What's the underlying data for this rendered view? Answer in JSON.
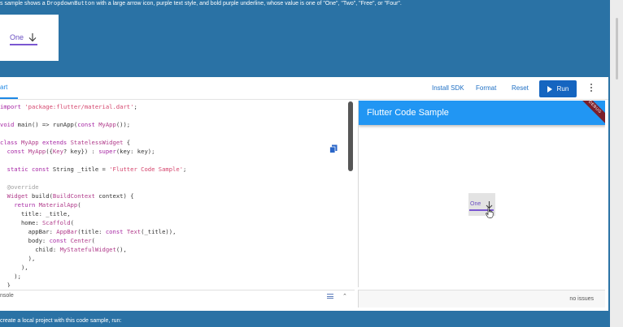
{
  "description": {
    "prefix": "s sample shows a ",
    "code": "DropdownButton",
    "suffix": " with a large arrow icon, purple text style, and bold purple underline, whose value is one of \"One\", \"Two\", \"Free\", or \"Four\"."
  },
  "sample_card": {
    "value": "One"
  },
  "toolbar": {
    "tab": "art",
    "install_sdk": "Install SDK",
    "format": "Format",
    "reset": "Reset",
    "run": "Run"
  },
  "code_lines": [
    [
      [
        "kw",
        "import "
      ],
      [
        "st",
        "'package:flutter/material.dart'"
      ],
      [
        "",
        "; "
      ]
    ],
    [],
    [
      [
        "kw",
        "void "
      ],
      [
        "",
        "main() => runApp("
      ],
      [
        "kw",
        "const "
      ],
      [
        "ty",
        "MyApp"
      ],
      [
        "",
        "());"
      ]
    ],
    [],
    [
      [
        "kw",
        "class "
      ],
      [
        "ty",
        "MyApp "
      ],
      [
        "kw",
        "extends "
      ],
      [
        "ty",
        "StatelessWidget"
      ],
      [
        "",
        " {"
      ]
    ],
    [
      [
        "",
        "  "
      ],
      [
        "kw",
        "const "
      ],
      [
        "ty",
        "MyApp"
      ],
      [
        "",
        "({"
      ],
      [
        "ty",
        "Key"
      ],
      [
        "",
        "? key}) : "
      ],
      [
        "kw",
        "super"
      ],
      [
        "",
        "(key: key);"
      ]
    ],
    [],
    [
      [
        "",
        "  "
      ],
      [
        "kw",
        "static const "
      ],
      [
        "",
        "String _title = "
      ],
      [
        "st",
        "'Flutter Code Sample'"
      ],
      [
        "",
        ";"
      ]
    ],
    [],
    [
      [
        "an",
        "  @override"
      ]
    ],
    [
      [
        "",
        "  "
      ],
      [
        "ty",
        "Widget "
      ],
      [
        "",
        "build("
      ],
      [
        "ty",
        "BuildContext "
      ],
      [
        "",
        "context) {"
      ]
    ],
    [
      [
        "",
        "    "
      ],
      [
        "kw",
        "return "
      ],
      [
        "ty",
        "MaterialApp"
      ],
      [
        "",
        "("
      ]
    ],
    [
      [
        "",
        "      title: _title,"
      ]
    ],
    [
      [
        "",
        "      home: "
      ],
      [
        "ty",
        "Scaffold"
      ],
      [
        "",
        "("
      ]
    ],
    [
      [
        "",
        "        appBar: "
      ],
      [
        "ty",
        "AppBar"
      ],
      [
        "",
        "(title: "
      ],
      [
        "kw",
        "const "
      ],
      [
        "ty",
        "Text"
      ],
      [
        "",
        "(_title)),"
      ]
    ],
    [
      [
        "",
        "        body: "
      ],
      [
        "kw",
        "const "
      ],
      [
        "ty",
        "Center"
      ],
      [
        "",
        "("
      ]
    ],
    [
      [
        "",
        "          child: "
      ],
      [
        "ty",
        "MyStatefulWidget"
      ],
      [
        "",
        "(),"
      ]
    ],
    [
      [
        "",
        "        ),"
      ]
    ],
    [
      [
        "",
        "      ),"
      ]
    ],
    [
      [
        "",
        "    );"
      ]
    ],
    [
      [
        "",
        "  }"
      ]
    ]
  ],
  "console": {
    "label": "nsole"
  },
  "preview": {
    "app_title": "Flutter Code Sample",
    "debug_banner": "DEBUG",
    "dropdown_value": "One"
  },
  "status": {
    "issues": "no issues"
  },
  "bottom_text": "create a local project with this code sample, run:"
}
